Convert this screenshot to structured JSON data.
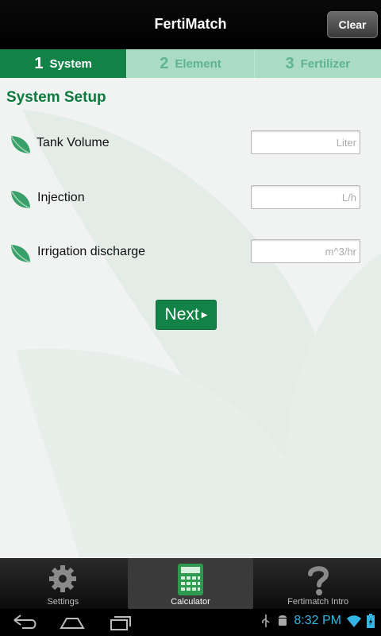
{
  "header": {
    "title": "FertiMatch",
    "clear_label": "Clear"
  },
  "steps": [
    {
      "number": "1",
      "label": "System",
      "active": true
    },
    {
      "number": "2",
      "label": "Element",
      "active": false
    },
    {
      "number": "3",
      "label": "Fertilizer",
      "active": false
    }
  ],
  "section": {
    "title": "System Setup"
  },
  "fields": [
    {
      "label": "Tank Volume",
      "value": "",
      "placeholder": "Liter"
    },
    {
      "label": "Injection",
      "value": "",
      "placeholder": "L/h"
    },
    {
      "label": "Irrigation discharge",
      "value": "",
      "placeholder": "m^3/hr"
    }
  ],
  "next_label": "Next",
  "tabs": [
    {
      "label": "Settings",
      "icon": "gear-icon",
      "active": false
    },
    {
      "label": "Calculator",
      "icon": "calculator-icon",
      "active": true
    },
    {
      "label": "Fertimatch Intro",
      "icon": "question-icon",
      "active": false
    }
  ],
  "system_bar": {
    "clock": "8:32 PM"
  },
  "colors": {
    "brand_green": "#128246",
    "step_inactive": "#a9dcc3",
    "clock_blue": "#33b5e5"
  }
}
